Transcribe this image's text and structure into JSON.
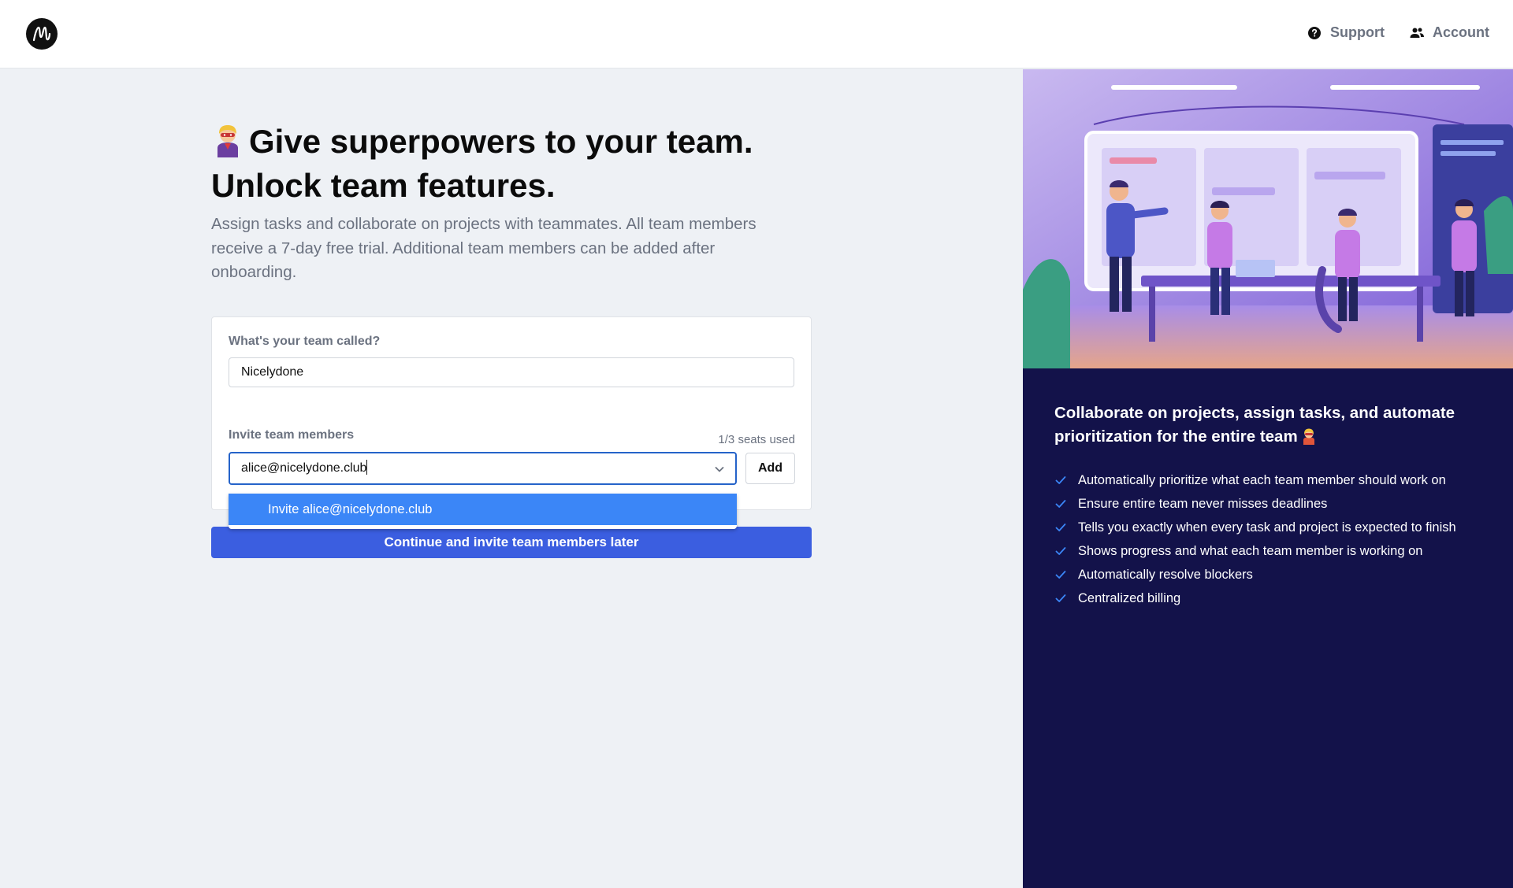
{
  "topbar": {
    "logo_icon": "brand-m-logo",
    "support_label": "Support",
    "account_label": "Account",
    "support_icon": "question-circle-icon",
    "account_icon": "users-icon"
  },
  "main": {
    "headline_line1": "Give superpowers to your team.",
    "headline_line2": "Unlock team features.",
    "headline_icon": "superhero-emoji",
    "subtext": "Assign tasks and collaborate on projects with teammates. All team members receive a 7-day free trial. Additional team members can be added after onboarding."
  },
  "form": {
    "team_label": "What's your team called?",
    "team_value": "Nicelydone",
    "invite_label": "Invite team members",
    "seats": "1/3 seats used",
    "invite_value": "alice@nicelydone.club",
    "add_label": "Add",
    "dropdown_option": "Invite alice@nicelydone.club",
    "continue_label": "Continue and invite team members later"
  },
  "right_panel": {
    "title": "Collaborate on projects, assign tasks, and automate prioritization for the entire team",
    "features": [
      "Automatically prioritize what each team member should work on",
      "Ensure entire team never misses deadlines",
      "Tells you exactly when every task and project is expected to finish",
      "Shows progress and what each team member is working on",
      "Automatically resolve blockers",
      "Centralized billing"
    ]
  },
  "colors": {
    "primary": "#3b5ee0",
    "dropdown_highlight": "#3b86f7",
    "focus_border": "#2563c9",
    "panel_bg": "#13124a",
    "check": "#3b86f7"
  }
}
